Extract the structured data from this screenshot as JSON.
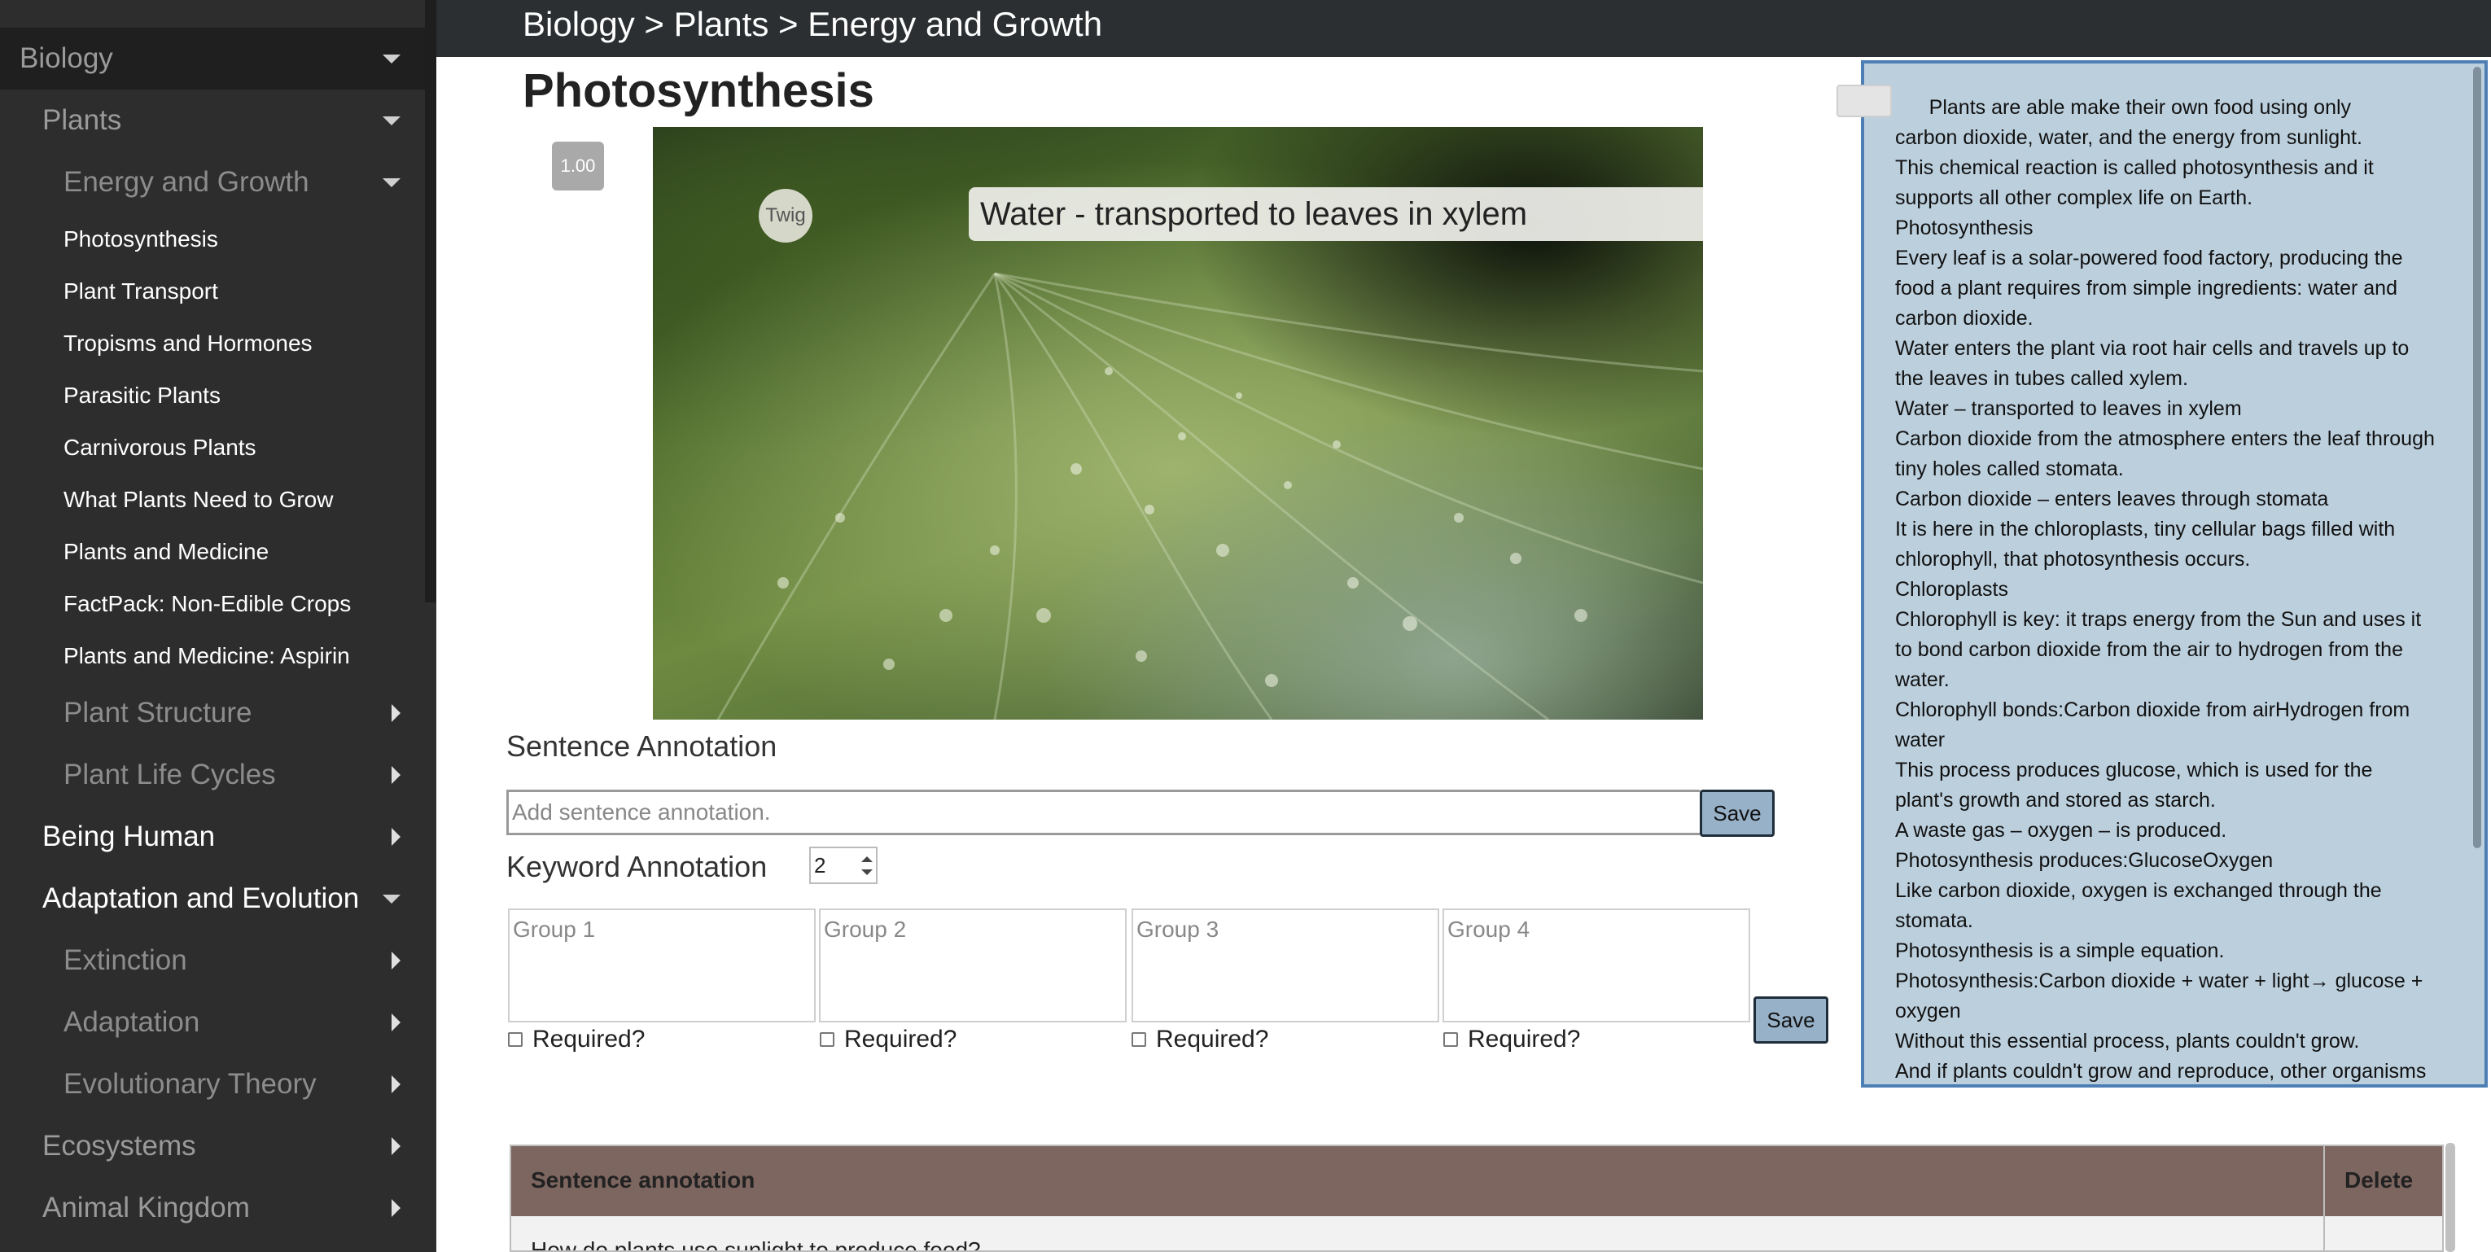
{
  "sidebar": {
    "items": [
      {
        "label": "Biology",
        "level": 0,
        "arrow": "down"
      },
      {
        "label": "Plants",
        "level": 1,
        "arrow": "down"
      },
      {
        "label": "Energy and Growth",
        "level": 2,
        "arrow": "down"
      },
      {
        "label": "Photosynthesis",
        "level": 3
      },
      {
        "label": "Plant Transport",
        "level": 3
      },
      {
        "label": "Tropisms and Hormones",
        "level": 3
      },
      {
        "label": "Parasitic Plants",
        "level": 3
      },
      {
        "label": "Carnivorous Plants",
        "level": 3
      },
      {
        "label": "What Plants Need to Grow",
        "level": 3
      },
      {
        "label": "Plants and Medicine",
        "level": 3
      },
      {
        "label": "FactPack: Non-Edible Crops",
        "level": 3
      },
      {
        "label": "Plants and Medicine: Aspirin",
        "level": 3
      },
      {
        "label": "Plant Structure",
        "level": 2,
        "arrow": "right"
      },
      {
        "label": "Plant Life Cycles",
        "level": 2,
        "arrow": "right"
      },
      {
        "label": "Being Human",
        "level": 1,
        "arrow": "right",
        "bright": true
      },
      {
        "label": "Adaptation and Evolution",
        "level": 1,
        "arrow": "down",
        "bright": true
      },
      {
        "label": "Extinction",
        "level": 2,
        "arrow": "right"
      },
      {
        "label": "Adaptation",
        "level": 2,
        "arrow": "right"
      },
      {
        "label": "Evolutionary Theory",
        "level": 2,
        "arrow": "right"
      },
      {
        "label": "Ecosystems",
        "level": 1,
        "arrow": "right"
      },
      {
        "label": "Animal Kingdom",
        "level": 1,
        "arrow": "right"
      }
    ]
  },
  "header": {
    "breadcrumb": "Biology > Plants > Energy and Growth"
  },
  "main": {
    "title": "Photosynthesis",
    "video": {
      "speed": "1.00",
      "logo": "Twig",
      "caption": "Water - transported to leaves in xylem"
    },
    "sentence_annotation": {
      "title": "Sentence Annotation",
      "placeholder": "Add sentence annotation.",
      "save_label": "Save"
    },
    "keyword_annotation": {
      "title": "Keyword Annotation",
      "count": "2",
      "groups": [
        "Group 1",
        "Group 2",
        "Group 3",
        "Group 4"
      ],
      "required_label": "Required?",
      "save_label": "Save"
    },
    "table": {
      "headers": {
        "sentence": "Sentence annotation",
        "delete": "Delete"
      },
      "rows": [
        {
          "sentence": "How do plants use sunlight to produce food?"
        }
      ]
    }
  },
  "transcript": {
    "lines": [
      "      Plants are able make their own food using only",
      "carbon dioxide, water, and the energy from sunlight.",
      "This chemical reaction is called photosynthesis and it",
      "supports all other complex life on Earth.",
      "Photosynthesis",
      "Every leaf is a solar-powered food factory, producing the",
      "food a plant requires from simple ingredients: water and",
      "carbon dioxide.",
      "Water enters the plant via root hair cells and travels up to",
      "the leaves in tubes called xylem.",
      "Water – transported to leaves in xylem",
      "Carbon dioxide from the atmosphere enters the leaf through",
      "tiny holes called stomata.",
      "Carbon dioxide – enters leaves through stomata",
      "It is here in the chloroplasts, tiny cellular bags filled with",
      "chlorophyll, that photosynthesis occurs.",
      "Chloroplasts",
      "Chlorophyll is key: it traps energy from the Sun and uses it",
      "to bond carbon dioxide from the air to hydrogen from the",
      "water.",
      "Chlorophyll bonds:Carbon dioxide from airHydrogen from",
      "water",
      "This process produces glucose, which is used for the",
      "plant's growth and stored as starch.",
      "A waste gas – oxygen – is produced.",
      "Photosynthesis produces:GlucoseOxygen",
      "Like carbon dioxide, oxygen is exchanged through the",
      "stomata.",
      "Photosynthesis is a simple equation.",
      "Photosynthesis:Carbon dioxide + water + light→ glucose +",
      "oxygen",
      "Without this essential process, plants couldn't grow.",
      "And if plants couldn't grow and reproduce, other organisms"
    ]
  },
  "colors": {
    "sidebar_bg": "#2d2d2d",
    "header_bg": "#2b2f31",
    "transcript_bg": "#bccfdd",
    "transcript_border": "#4d7fb5",
    "save_button": "#97b1c8",
    "table_header": "#7e6660"
  }
}
